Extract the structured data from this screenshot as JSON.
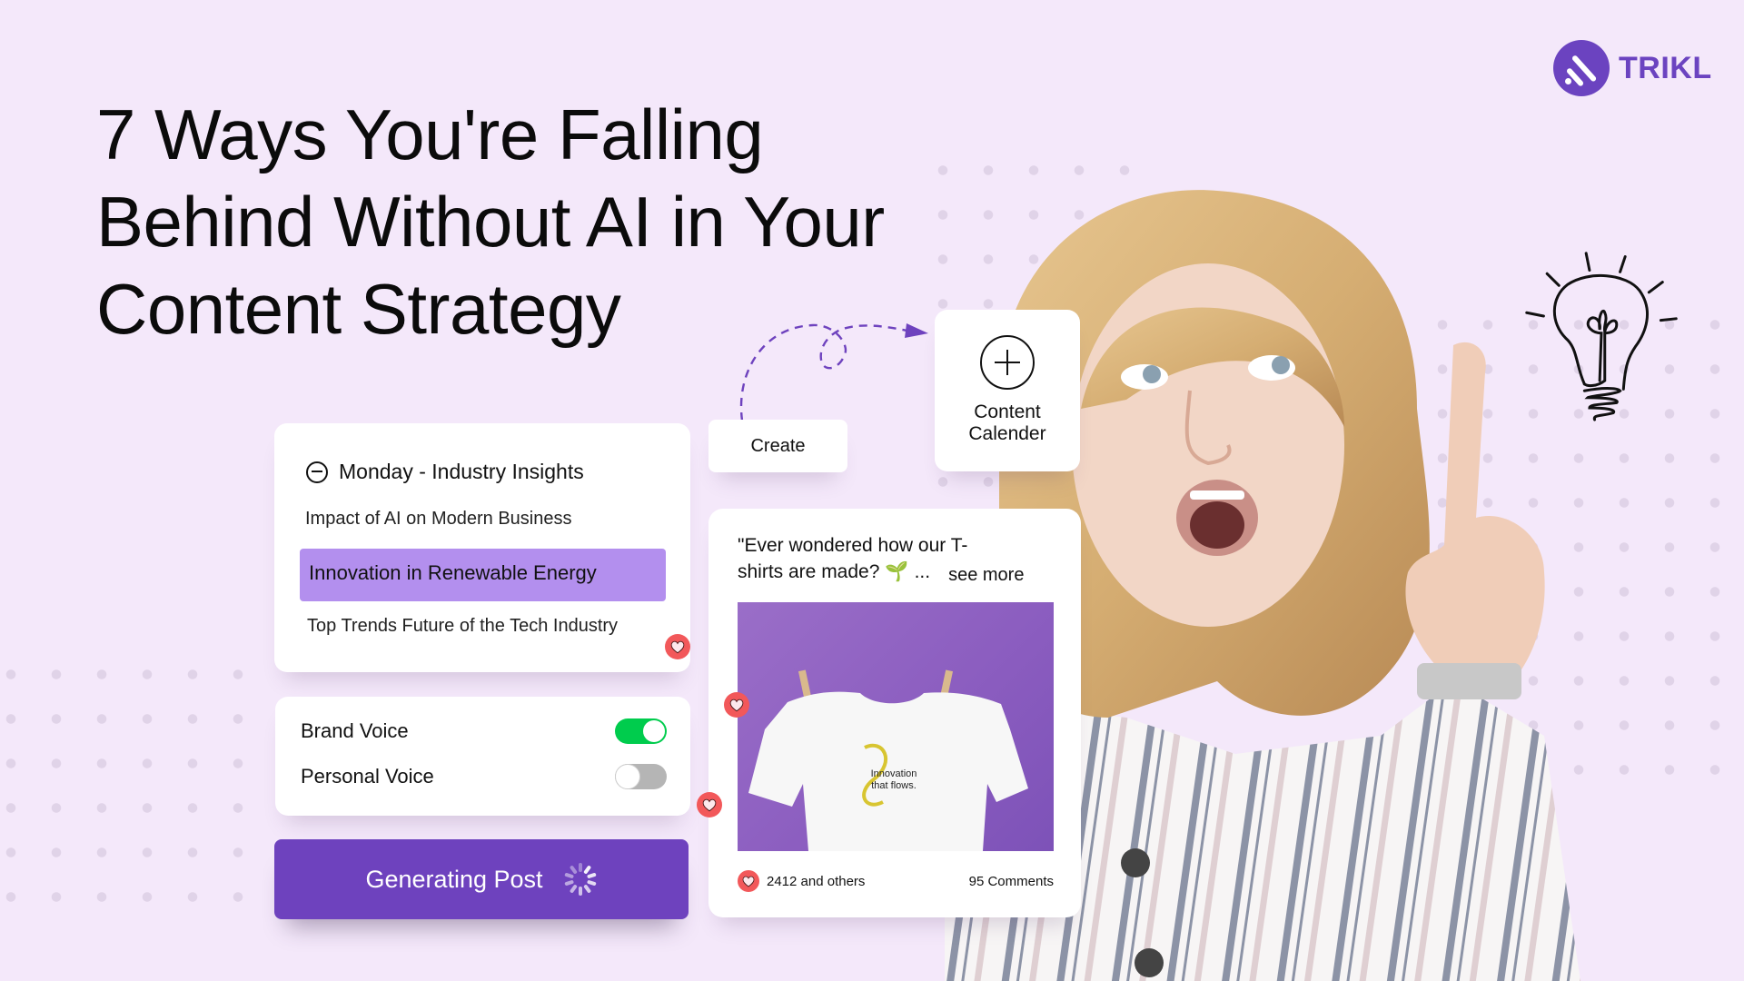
{
  "brand": {
    "name": "TRIKL",
    "icon": "trikl-logo-icon",
    "color": "#6b43c0"
  },
  "headline": {
    "lines": [
      "7 Ways You're Falling",
      "Behind Without AI in Your",
      "Content Strategy"
    ]
  },
  "topics_card": {
    "header_icon": "minus-circle-icon",
    "header": "Monday - Industry Insights",
    "items": [
      {
        "label": "Impact of AI on Modern Business",
        "selected": false
      },
      {
        "label": "Innovation in Renewable Energy",
        "selected": true
      },
      {
        "label": "Top Trends Future of the Tech Industry",
        "selected": false
      }
    ],
    "highlight_color": "#b38fee"
  },
  "voice_card": {
    "options": [
      {
        "label": "Brand Voice",
        "enabled": true
      },
      {
        "label": "Personal Voice",
        "enabled": false
      }
    ],
    "on_color": "#00cc4d",
    "off_color": "#b5b5b5"
  },
  "generate_button": {
    "label": "Generating Post",
    "icon": "loading-spinner-icon",
    "color": "#6e42be"
  },
  "flow": {
    "create_label": "Create",
    "calendar_icon": "plus-circle-icon",
    "calendar_label_line1": "Content",
    "calendar_label_line2": "Calender"
  },
  "post_card": {
    "text_line1": "\"Ever wondered how our T-",
    "text_line2": "shirts are made?",
    "emoji": "sprout-icon",
    "ellipsis": "...",
    "see_more": "see more",
    "image_alt": "White t-shirt on purple background",
    "shirt_print_line1": "Innovation",
    "shirt_print_line2": "that flows.",
    "likes": "2412 and others",
    "comments": "95 Comments"
  },
  "colors": {
    "background": "#f4e8fa",
    "heart": "#f2585a",
    "accent": "#6e42be"
  }
}
